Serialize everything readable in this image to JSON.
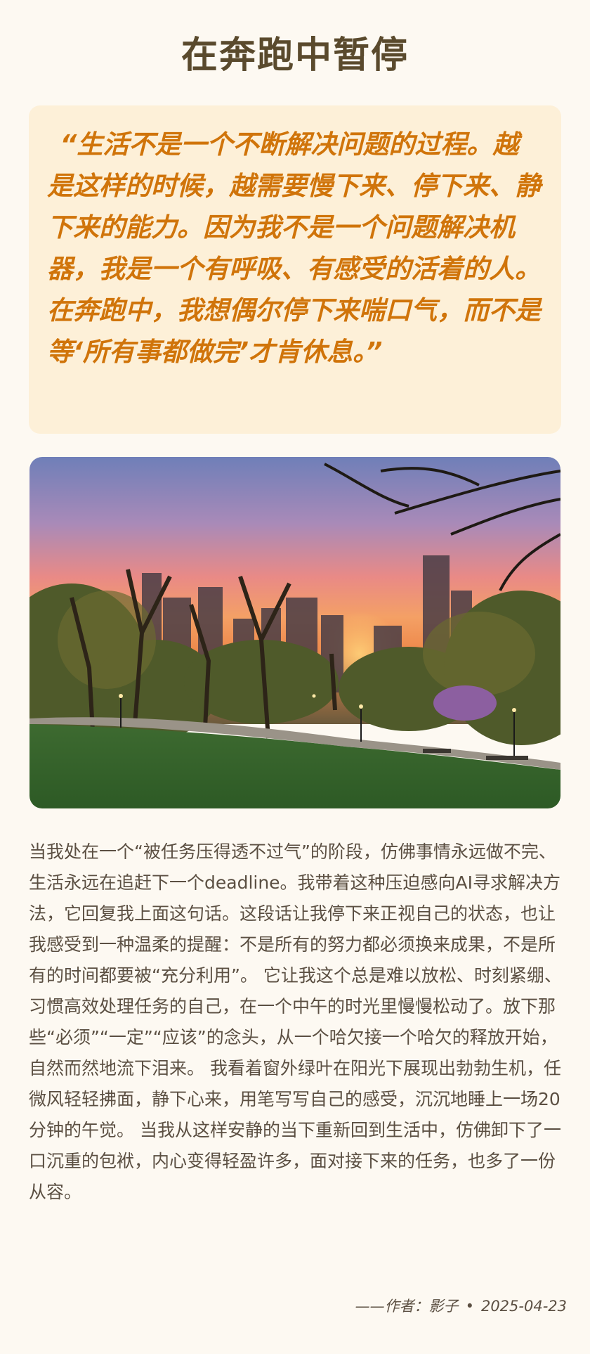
{
  "title": "在奔跑中暂停",
  "quote": "“生活不是一个不断解决问题的过程。越是这样的时候，越需要慢下来、停下来、静下来的能力。因为我不是一个问题解决机器，我是一个有呼吸、有感受的活着的人。在奔跑中，我想偶尔停下来喘口气，而不是等‘所有事都做完’才肯休息。”",
  "body": "当我处在一个“被任务压得透不过气”的阶段，仿佛事情永远做不完、生活永远在追赶下一个deadline。我带着这种压迫感向AI寻求解决方法，它回复我上面这句话。这段话让我停下来正视自己的状态，也让我感受到一种温柔的提醒：不是所有的努力都必须换来成果，不是所有的时间都要被“充分利用”。 它让我这个总是难以放松、时刻紧绷、习惯高效处理任务的自己，在一个中午的时光里慢慢松动了。放下那些“必须”“一定”“应该”的念头，从一个哈欠接一个哈欠的释放开始，自然而然地流下泪来。 我看着窗外绿叶在阳光下展现出勃勃生机，任微风轻轻拂面，静下心来，用笔写写自己的感受，沉沉地睡上一场20分钟的午觉。 当我从这样安静的当下重新回到生活中，仿佛卸下了一口沉重的包袱，内心变得轻盈许多，面对接下来的任务，也多了一份从容。",
  "footer": {
    "author": "——作者：影子",
    "separator": "•",
    "date": "2025-04-23"
  },
  "image": {
    "subject": "park-sunset-photo"
  },
  "colors": {
    "background": "#fdf9f2",
    "title": "#5a4a2d",
    "quote_bg": "#fdf0d8",
    "quote_text": "#d0740a",
    "body_text": "#5b4f42"
  }
}
